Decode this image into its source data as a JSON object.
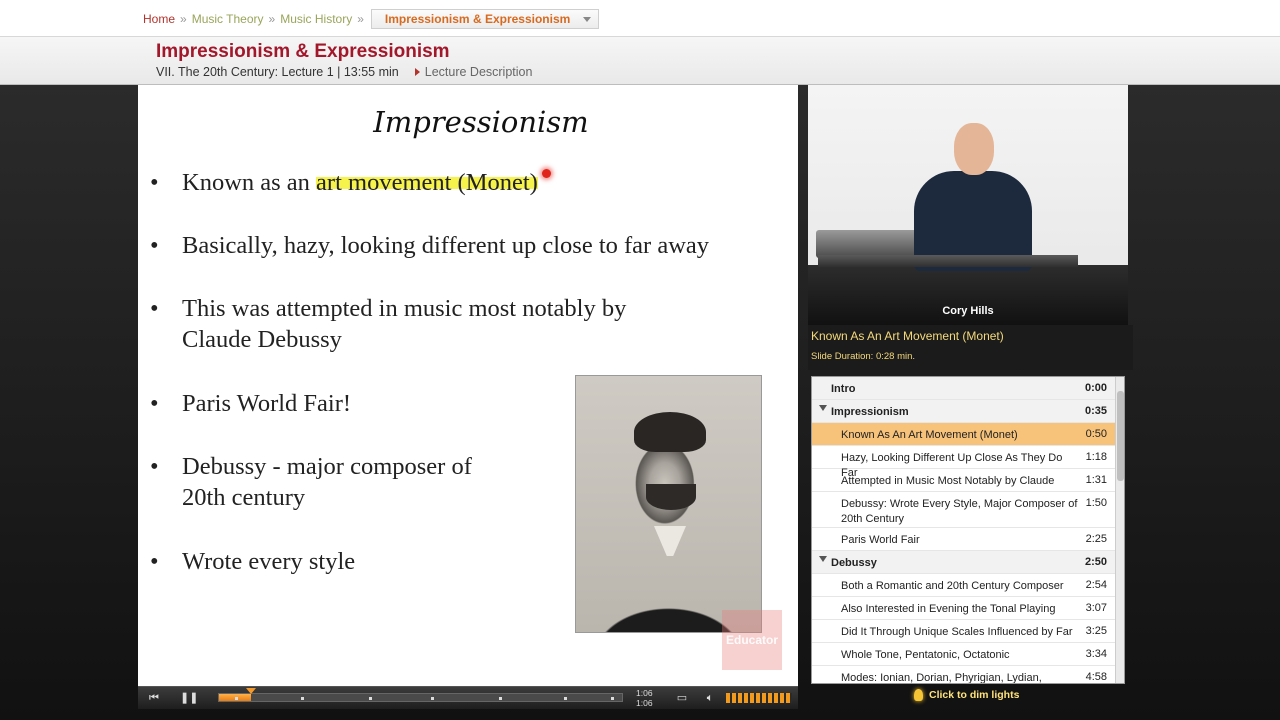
{
  "breadcrumb": {
    "home": "Home",
    "sep": "»",
    "course": "Music Theory",
    "section": "Music History",
    "current": "Impressionism & Expressionism"
  },
  "header": {
    "title": "Impressionism & Expressionism",
    "meta": "VII. The 20th Century: Lecture 1 | 13:55 min",
    "description_link": "Lecture Description"
  },
  "slide": {
    "title": "Impressionism",
    "bullet_symbol": "•",
    "bullets": [
      {
        "pre": "Known as an ",
        "highlight": "art movement (Monet)"
      },
      {
        "text": "Basically, hazy, looking different up close to far away"
      },
      {
        "line1": "This was attempted in music most notably by",
        "line2": "Claude Debussy"
      },
      {
        "text": "Paris World Fair!"
      },
      {
        "line1": "Debussy - major composer of",
        "line2": "20th century"
      },
      {
        "text": "Wrote every style"
      }
    ],
    "watermark": "Educator"
  },
  "player": {
    "time_current": "1:06",
    "time_total": "1:06",
    "progress": 0.08
  },
  "video": {
    "presenter": "Cory Hills"
  },
  "now_playing": {
    "title": "Known As An Art Movement (Monet)",
    "duration": "Slide Duration: 0:28 min."
  },
  "toc": [
    {
      "label": "Intro",
      "time": "0:00",
      "type": "section"
    },
    {
      "label": "Impressionism",
      "time": "0:35",
      "type": "section",
      "expanded": true
    },
    {
      "label": "Known As An Art Movement (Monet)",
      "time": "0:50",
      "type": "item",
      "active": true
    },
    {
      "label": "Hazy, Looking Different Up Close As They Do Far",
      "time": "1:18",
      "type": "item"
    },
    {
      "label": "Attempted in Music Most Notably by Claude",
      "time": "1:31",
      "type": "item"
    },
    {
      "label": "Debussy: Wrote Every Style, Major Composer of 20th Century",
      "time": "1:50",
      "type": "item"
    },
    {
      "label": "Paris World Fair",
      "time": "2:25",
      "type": "item"
    },
    {
      "label": "Debussy",
      "time": "2:50",
      "type": "section",
      "expanded": true
    },
    {
      "label": "Both a Romantic and 20th Century Composer",
      "time": "2:54",
      "type": "item"
    },
    {
      "label": "Also Interested in Evening the Tonal Playing",
      "time": "3:07",
      "type": "item"
    },
    {
      "label": "Did It Through Unique Scales Influenced by Far",
      "time": "3:25",
      "type": "item"
    },
    {
      "label": "Whole Tone, Pentatonic, Octatonic",
      "time": "3:34",
      "type": "item"
    },
    {
      "label": "Modes: Ionian, Dorian, Phyrigian, Lydian,",
      "time": "4:58",
      "type": "item"
    }
  ],
  "dim_lights": "Click to dim lights",
  "colors": {
    "title_red": "#a3172b",
    "accent_orange": "#f29a1e",
    "highlight_yellow": "#f7f34d",
    "active_row": "#f7c27a"
  }
}
